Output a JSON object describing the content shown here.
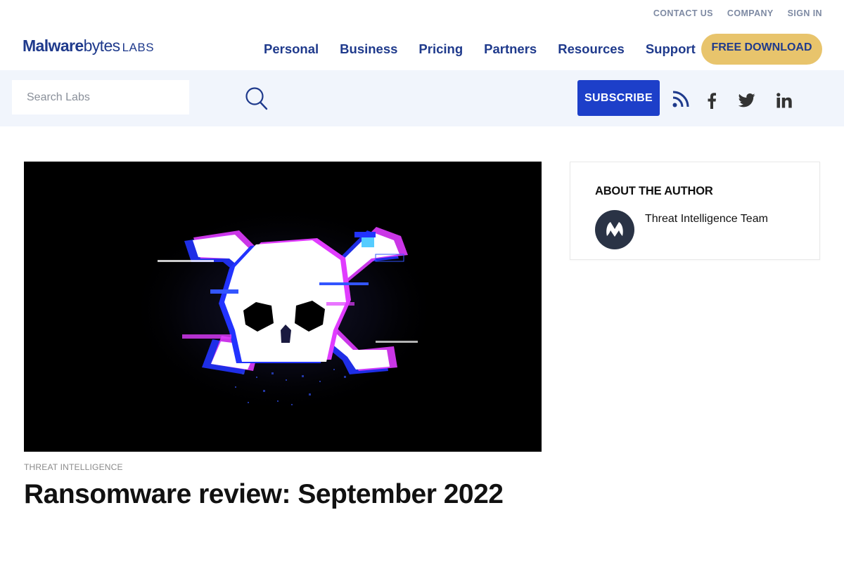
{
  "header": {
    "utility_links": [
      "CONTACT US",
      "COMPANY",
      "SIGN IN"
    ],
    "logo": {
      "bold": "Malware",
      "light": "bytes",
      "suffix": "LABS"
    },
    "nav_items": [
      "Personal",
      "Business",
      "Pricing",
      "Partners",
      "Resources",
      "Support"
    ],
    "download_label": "FREE DOWNLOAD"
  },
  "subbar": {
    "search_placeholder": "Search Labs",
    "subscribe_label": "SUBSCRIBE",
    "social_icons": [
      "rss-icon",
      "facebook-icon",
      "twitter-icon",
      "linkedin-icon"
    ]
  },
  "article": {
    "category": "THREAT INTELLIGENCE",
    "title": "Ransomware review: September 2022"
  },
  "author": {
    "heading": "ABOUT THE AUTHOR",
    "name": "Threat Intelligence Team"
  },
  "colors": {
    "brand_navy": "#1f3a8c",
    "download_yellow": "#e8c46c",
    "subscribe_blue": "#1d3fc9",
    "subbar_bg": "#f1f5fc"
  }
}
